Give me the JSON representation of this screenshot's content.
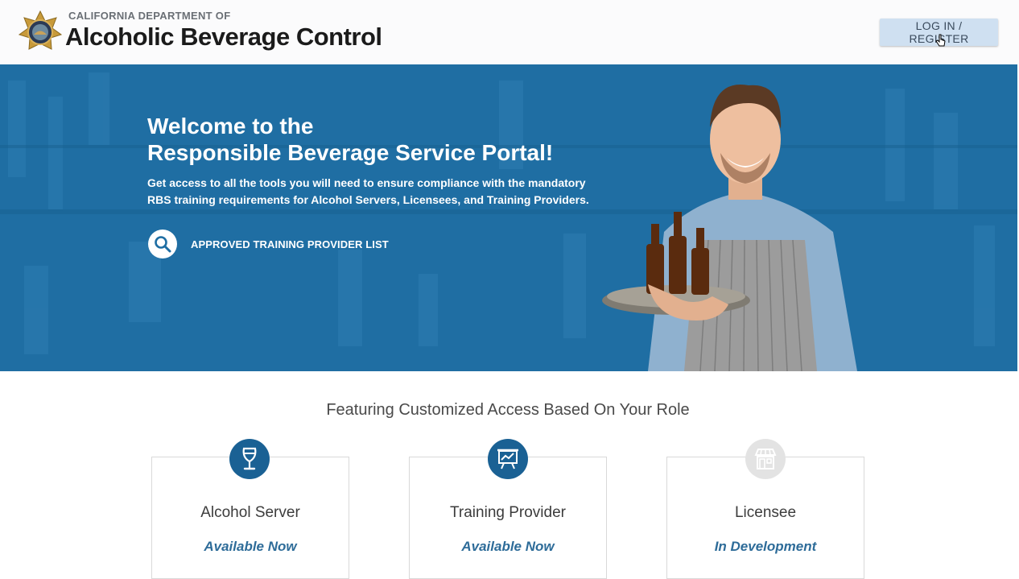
{
  "header": {
    "department": "CALIFORNIA DEPARTMENT OF",
    "organization": "Alcoholic Beverage Control",
    "login_label": "LOG IN / REGISTER",
    "seal_icon": "state-seal-icon"
  },
  "hero": {
    "title_line1": "Welcome to the",
    "title_line2": "Responsible Beverage Service Portal!",
    "description": "Get access to all the tools you will need to ensure compliance with the mandatory RBS training requirements for Alcohol Servers, Licensees, and Training Providers.",
    "provider_link": "APPROVED TRAINING PROVIDER LIST",
    "accent_color": "#1f6ea3"
  },
  "features": {
    "heading": "Featuring Customized Access Based On Your Role",
    "cards": [
      {
        "title": "Alcohol Server",
        "status": "Available Now",
        "icon": "wine-glass-icon",
        "icon_color": "#1a6194"
      },
      {
        "title": "Training Provider",
        "status": "Available Now",
        "icon": "presentation-board-icon",
        "icon_color": "#1a6194"
      },
      {
        "title": "Licensee",
        "status": "In Development",
        "icon": "storefront-icon",
        "icon_color": "#e3e3e3"
      }
    ]
  }
}
